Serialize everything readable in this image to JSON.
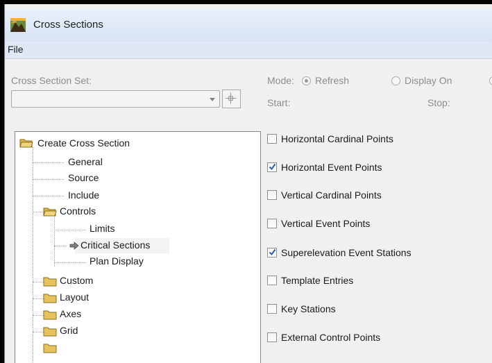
{
  "window": {
    "title": "Cross Sections"
  },
  "menu": {
    "file": "File"
  },
  "set_section": {
    "label": "Cross Section Set:",
    "value": ""
  },
  "mode": {
    "label": "Mode:",
    "options": [
      {
        "label": "Refresh",
        "selected": true
      },
      {
        "label": "Display On",
        "selected": false
      }
    ]
  },
  "range": {
    "start_label": "Start:",
    "stop_label": "Stop:"
  },
  "tree": {
    "root": "Create Cross Section",
    "items": [
      "General",
      "Source",
      "Include"
    ],
    "controls": {
      "label": "Controls",
      "children": [
        "Limits",
        "Critical Sections",
        "Plan Display"
      ],
      "selected": "Critical Sections"
    },
    "folders": [
      "Custom",
      "Layout",
      "Axes",
      "Grid"
    ]
  },
  "options": [
    {
      "label": "Horizontal Cardinal Points",
      "checked": false
    },
    {
      "label": "Horizontal Event Points",
      "checked": true
    },
    {
      "label": "Vertical Cardinal Points",
      "checked": false
    },
    {
      "label": "Vertical Event Points",
      "checked": false
    },
    {
      "label": "Superelevation Event Stations",
      "checked": true
    },
    {
      "label": "Template Entries",
      "checked": false
    },
    {
      "label": "Key Stations",
      "checked": false
    },
    {
      "label": "External Control Points",
      "checked": false
    }
  ],
  "colors": {
    "accent_check": "#2a5ea8",
    "folder": "#e7c45a",
    "disabled_text": "#8c8c8c"
  }
}
